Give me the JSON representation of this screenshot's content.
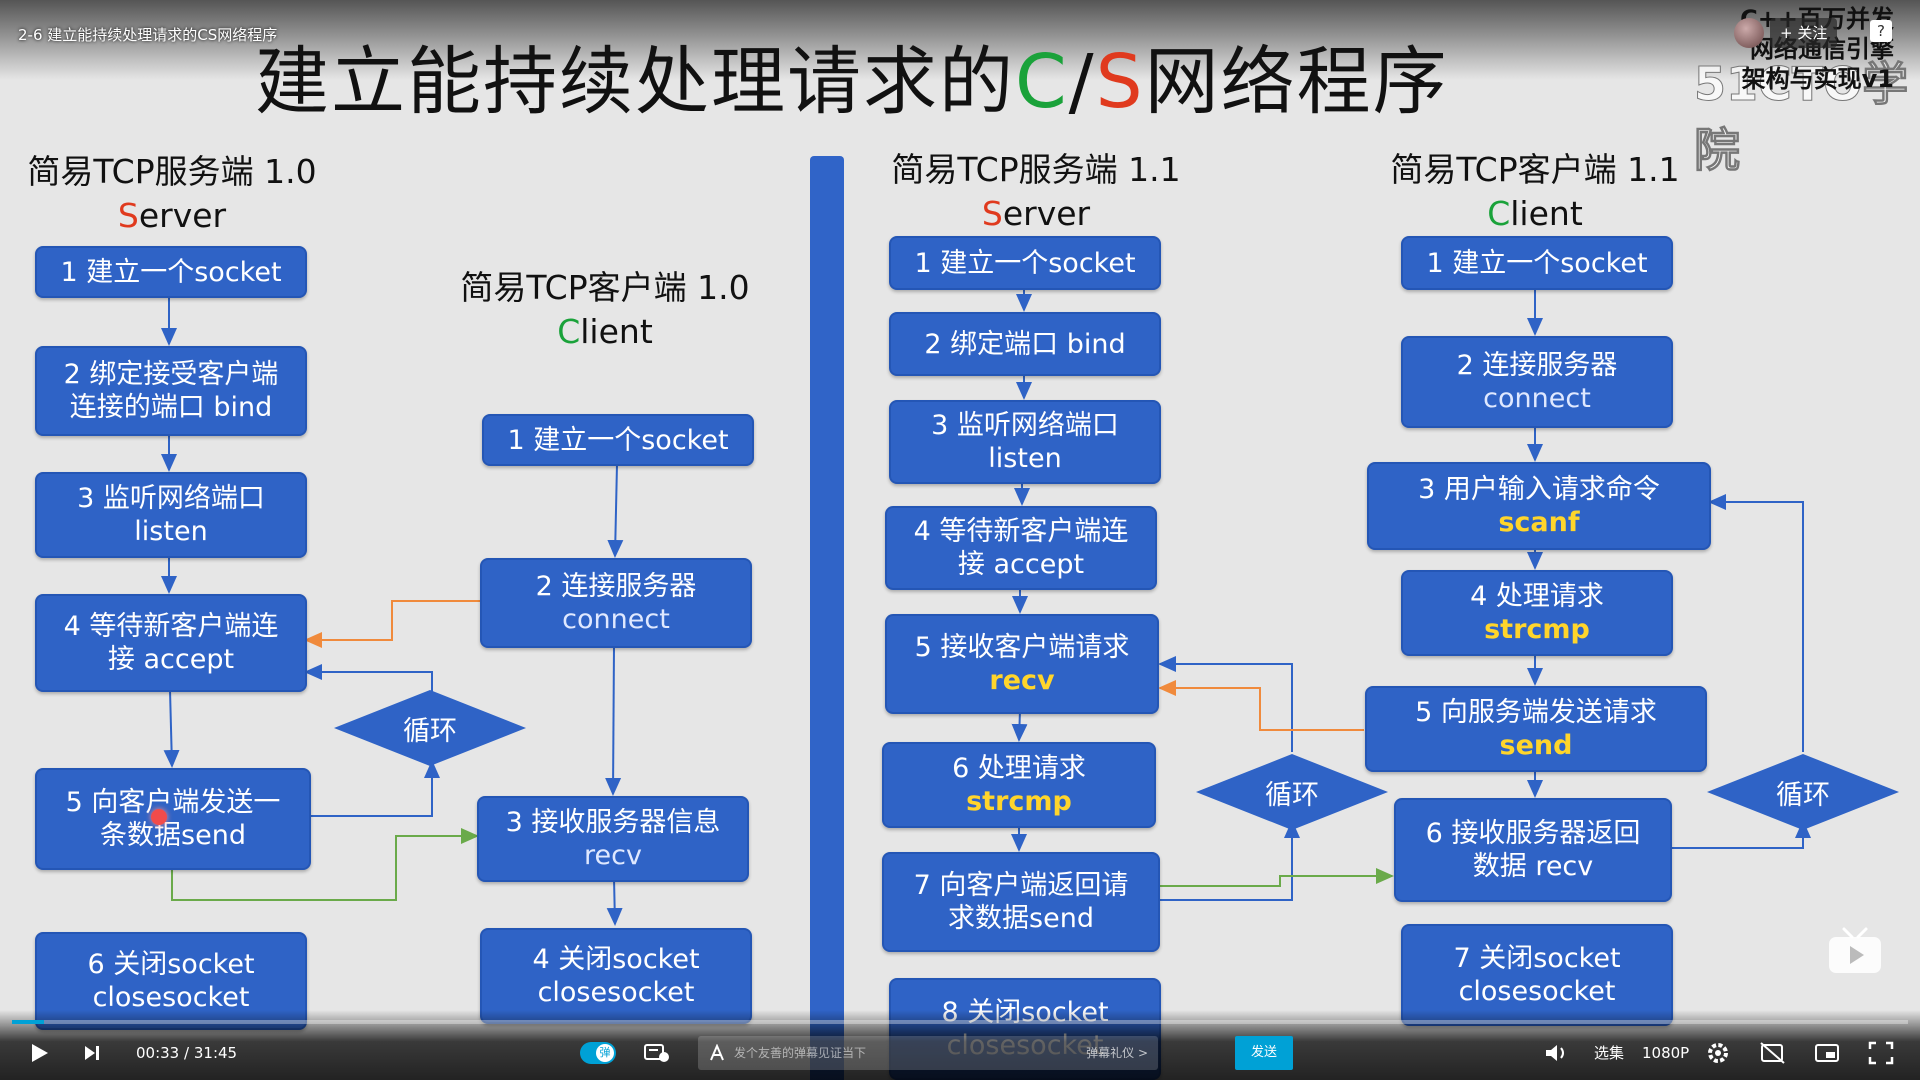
{
  "video_title": "2-6 建立能持续处理请求的CS网络程序",
  "slide": {
    "title_prefix": "建立能持续处理请求的",
    "title_c": "C",
    "title_slash": "/",
    "title_s": "S",
    "title_suffix": "网络程序"
  },
  "watermark": {
    "line1": "C++百万并发",
    "line2": "网络通信引擎",
    "line3": "架构与实现v1",
    "big": "51CTO学院"
  },
  "follow_label": "+ 关注",
  "help_label": "?",
  "server10": {
    "head": "简易TCP服务端 1.0",
    "role_first": "S",
    "role_rest": "erver",
    "steps": [
      {
        "l1": "1 建立一个socket",
        "l2": ""
      },
      {
        "l1": "2 绑定接受客户端",
        "l2": "连接的端口 bind"
      },
      {
        "l1": "3 监听网络端口",
        "l2": "listen"
      },
      {
        "l1": "4 等待新客户端连",
        "l2": "接 accept"
      },
      {
        "l1": "5 向客户端发送一",
        "l2": "条数据send"
      },
      {
        "l1": "6 关闭socket",
        "l2": "closesocket"
      }
    ]
  },
  "client10": {
    "head": "简易TCP客户端 1.0",
    "role_first": "C",
    "role_rest": "lient",
    "steps": [
      {
        "l1": "1 建立一个socket",
        "l2": ""
      },
      {
        "l1": "2 连接服务器",
        "l2": "connect"
      },
      {
        "l1": "3 接收服务器信息",
        "l2": "recv"
      },
      {
        "l1": "4 关闭socket",
        "l2": "closesocket"
      }
    ],
    "loop": "循环"
  },
  "server11": {
    "head": "简易TCP服务端 1.1",
    "role_first": "S",
    "role_rest": "erver",
    "steps": [
      {
        "l1": "1 建立一个socket",
        "l2": ""
      },
      {
        "l1": "2 绑定端口 bind",
        "l2": ""
      },
      {
        "l1": "3 监听网络端口",
        "l2": "listen"
      },
      {
        "l1": "4 等待新客户端连",
        "l2": "接 accept"
      },
      {
        "l1": "5 接收客户端请求",
        "l2": "recv"
      },
      {
        "l1": "6 处理请求",
        "l2": "strcmp"
      },
      {
        "l1": "7 向客户端返回请",
        "l2": "求数据send"
      },
      {
        "l1": "8 关闭socket",
        "l2": "closesocket"
      }
    ],
    "loop": "循环"
  },
  "client11": {
    "head": "简易TCP客户端 1.1",
    "role_first": "C",
    "role_rest": "lient",
    "steps": [
      {
        "l1": "1 建立一个socket",
        "l2": ""
      },
      {
        "l1": "2 连接服务器",
        "l2": "connect"
      },
      {
        "l1": "3 用户输入请求命令",
        "l2": "scanf"
      },
      {
        "l1": "4 处理请求",
        "l2": "strcmp"
      },
      {
        "l1": "5 向服务端发送请求",
        "l2": "send"
      },
      {
        "l1": "6 接收服务器返回",
        "l2": "数据 recv"
      },
      {
        "l1": "7 关闭socket",
        "l2": "closesocket"
      }
    ],
    "loop": "循环"
  },
  "player": {
    "time_current": "00:33",
    "time_sep": "/",
    "time_total": "31:45",
    "progress": 0.017,
    "danmu_toggle": "弹",
    "danmu_placeholder": "发个友善的弹幕见证当下",
    "danmu_etiquette": "弹幕礼仪 >",
    "send": "发送",
    "episodes": "选集",
    "quality": "1080P",
    "accent": "#00a1d6"
  }
}
